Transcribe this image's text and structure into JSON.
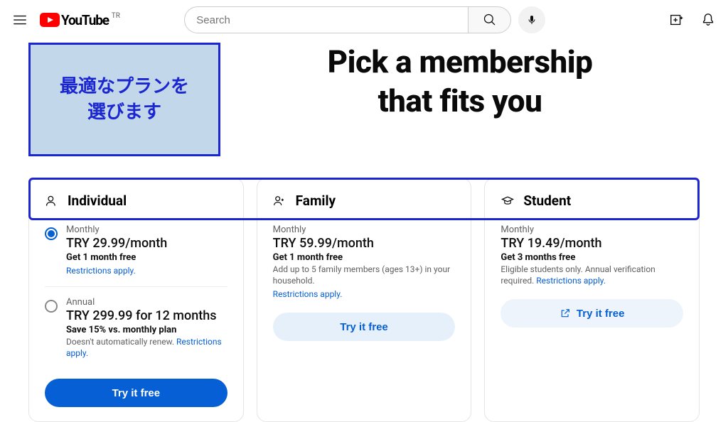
{
  "topbar": {
    "brand": "YouTube",
    "region": "TR",
    "search_placeholder": "Search"
  },
  "callout": {
    "line1": "最適なプランを",
    "line2": "選びます"
  },
  "hero": {
    "line1": "Pick a membership",
    "line2": "that fits you"
  },
  "plans": {
    "individual": {
      "title": "Individual",
      "monthly": {
        "period": "Monthly",
        "price": "TRY 29.99/month",
        "sub": "Get 1 month free",
        "restrictions": "Restrictions apply."
      },
      "annual": {
        "period": "Annual",
        "price": "TRY 299.99 for 12 months",
        "sub": "Save 15% vs. monthly plan",
        "desc_prefix": "Doesn't automatically renew. ",
        "restrictions": "Restrictions apply."
      },
      "cta": "Try it free"
    },
    "family": {
      "title": "Family",
      "period": "Monthly",
      "price": "TRY 59.99/month",
      "sub": "Get 1 month free",
      "desc": "Add up to 5 family members (ages 13+) in your household.",
      "restrictions": "Restrictions apply.",
      "cta": "Try it free"
    },
    "student": {
      "title": "Student",
      "period": "Monthly",
      "price": "TRY 19.49/month",
      "sub": "Get 3 months free",
      "desc_prefix": "Eligible students only. Annual verification required. ",
      "restrictions": "Restrictions apply.",
      "cta": "Try it free"
    }
  }
}
